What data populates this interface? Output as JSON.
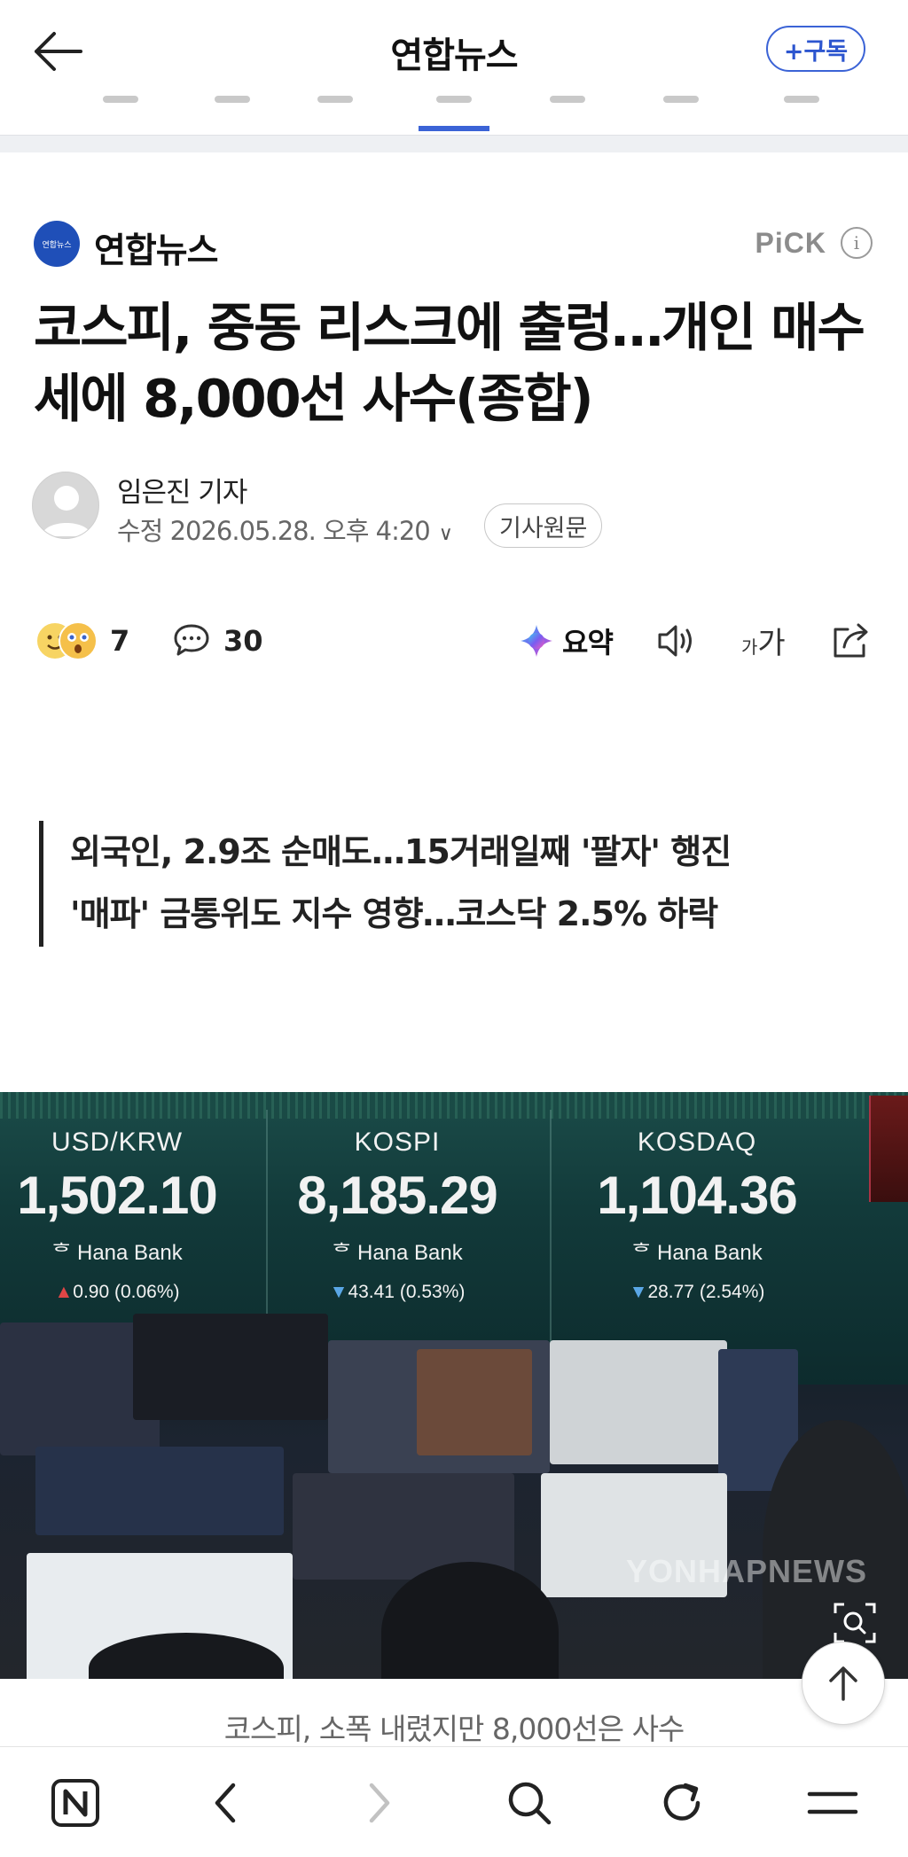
{
  "appbar": {
    "title": "연합뉴스",
    "subscribe_label": "+구독"
  },
  "press": {
    "logo_text": "연합뉴스",
    "name": "연합뉴스",
    "pick_label": "PiCK",
    "info_icon": "ⓘ"
  },
  "article": {
    "headline": "코스피, 중동 리스크에 출렁…개인 매수세에 8,000선 사수(종합)",
    "reporter": "임은진 기자",
    "modified": "수정 2026.05.28. 오후 4:20",
    "source_button": "기사원문"
  },
  "actions": {
    "reaction_count": "7",
    "comment_count": "30",
    "summary_label": "요약",
    "font_small": "가",
    "font_big": "가"
  },
  "quote": {
    "line1": "외국인, 2.9조 순매도…15거래일째 '팔자' 행진",
    "line2": "'매파' 금통위도 지수 영향…코스닥 2.5% 하락"
  },
  "photo": {
    "panels": [
      {
        "name": "USD/KRW",
        "value": "1,502.10",
        "bank": "Hana Bank",
        "change": "0.90 (0.06%)",
        "direction": "up"
      },
      {
        "name": "KOSPI",
        "value": "8,185.29",
        "bank": "Hana Bank",
        "change": "43.41 (0.53%)",
        "direction": "down"
      },
      {
        "name": "KOSDAQ",
        "value": "1,104.36",
        "bank": "Hana Bank",
        "change": "28.77 (2.54%)",
        "direction": "down"
      }
    ],
    "watermark": "YONHAPNEWS",
    "caption": "코스피, 소폭 내렸지만 8,000선은 사수"
  },
  "icons": {
    "back": "back-arrow-icon",
    "zoom": "zoom-icon",
    "scroll_top": "arrow-up-icon",
    "nav": [
      "naver-home-icon",
      "browser-back-icon",
      "browser-forward-icon",
      "search-icon",
      "refresh-icon",
      "menu-icon"
    ]
  },
  "colors": {
    "accent": "#3b63d6",
    "press_logo": "#1f4fb8",
    "up": "#e04646",
    "down": "#5aa7e6"
  }
}
